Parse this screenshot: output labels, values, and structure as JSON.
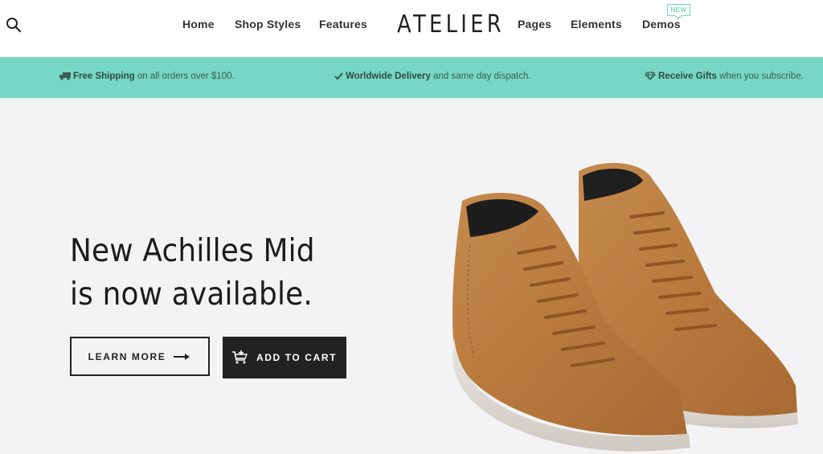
{
  "header": {
    "nav_left": [
      "Home",
      "Shop Styles",
      "Features"
    ],
    "logo": "ATELIER",
    "nav_right": [
      "Pages",
      "Elements",
      "Demos"
    ],
    "new_badge": "NEW",
    "search_icon": "search-icon"
  },
  "promo": {
    "items": [
      {
        "icon": "truck-icon",
        "bold": "Free Shipping",
        "text": " on all orders over $100."
      },
      {
        "icon": "check-icon",
        "bold": "Worldwide Delivery",
        "text": " and same day dispatch."
      },
      {
        "icon": "diamond-icon",
        "bold": "Receive Gifts",
        "text": " when you subscribe."
      }
    ],
    "bg_color": "#76d8c4"
  },
  "hero": {
    "title_line1": "New Achilles Mid",
    "title_line2": "is now available.",
    "learn_more": "LEARN MORE",
    "add_to_cart": "ADD TO CART",
    "product_image": "suede-high-top-sneakers"
  }
}
